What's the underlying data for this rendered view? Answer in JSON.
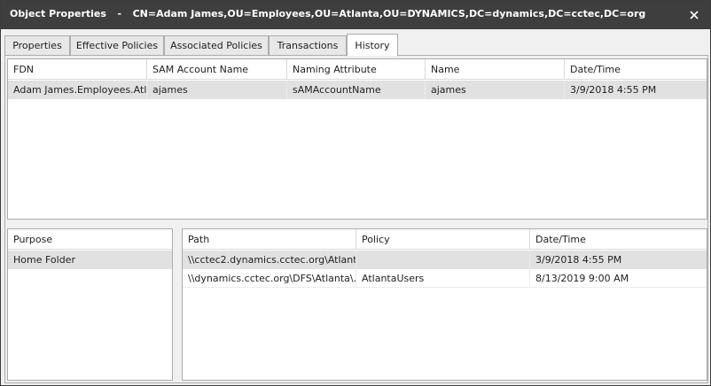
{
  "window": {
    "title": "Object Properties",
    "title_separator": "-",
    "title_object": "CN=Adam James,OU=Employees,OU=Atlanta,OU=DYNAMICS,DC=dynamics,DC=cctec,DC=org"
  },
  "tabs": [
    {
      "label": "Properties",
      "active": false
    },
    {
      "label": "Effective Policies",
      "active": false
    },
    {
      "label": "Associated Policies",
      "active": false
    },
    {
      "label": "Transactions",
      "active": false
    },
    {
      "label": "History",
      "active": true
    }
  ],
  "history_table": {
    "columns": [
      "FDN",
      "SAM Account Name",
      "Naming Attribute",
      "Name",
      "Date/Time"
    ],
    "rows": [
      {
        "fdn": "Adam James.Employees.Atl...",
        "sam": "ajames",
        "naming": "sAMAccountName",
        "name": "ajames",
        "datetime": "3/9/2018 4:55 PM",
        "selected": true
      }
    ]
  },
  "purpose_table": {
    "columns": [
      "Purpose"
    ],
    "rows": [
      {
        "purpose": "Home Folder",
        "selected": true
      }
    ]
  },
  "path_table": {
    "columns": [
      "Path",
      "Policy",
      "Date/Time"
    ],
    "rows": [
      {
        "path": "\\\\cctec2.dynamics.cctec.org\\Atlant...",
        "policy": "",
        "datetime": "3/9/2018 4:55 PM",
        "selected": true
      },
      {
        "path": "\\\\dynamics.cctec.org\\DFS\\Atlanta\\...",
        "policy": "AtlantaUsers",
        "datetime": "8/13/2019 9:00 AM",
        "selected": false
      }
    ]
  },
  "colors": {
    "titlebar": "#3e3e3e",
    "selected_row": "#e1e1e1",
    "border": "#acacac"
  }
}
